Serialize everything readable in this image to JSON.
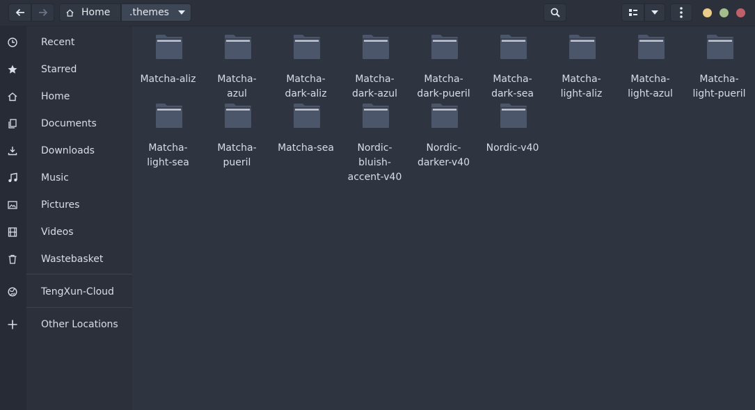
{
  "header": {
    "breadcrumb": [
      {
        "label": "Home"
      },
      {
        "label": ".themes"
      }
    ]
  },
  "sidebar": {
    "items": [
      {
        "label": "Recent",
        "icon": "clock-icon"
      },
      {
        "label": "Starred",
        "icon": "star-icon"
      },
      {
        "label": "Home",
        "icon": "home-icon"
      },
      {
        "label": "Documents",
        "icon": "document-icon"
      },
      {
        "label": "Downloads",
        "icon": "download-icon"
      },
      {
        "label": "Music",
        "icon": "music-icon"
      },
      {
        "label": "Pictures",
        "icon": "picture-icon"
      },
      {
        "label": "Videos",
        "icon": "video-icon"
      },
      {
        "label": "Wastebasket",
        "icon": "trash-icon"
      },
      {
        "label": "TengXun-Cloud",
        "icon": "network-icon"
      },
      {
        "label": "Other Locations",
        "icon": "plus-icon"
      }
    ]
  },
  "files": [
    {
      "name": "Matcha-aliz"
    },
    {
      "name": "Matcha-\nazul"
    },
    {
      "name": "Matcha-\ndark-aliz"
    },
    {
      "name": "Matcha-\ndark-azul"
    },
    {
      "name": "Matcha-\ndark-pueril"
    },
    {
      "name": "Matcha-\ndark-sea"
    },
    {
      "name": "Matcha-\nlight-aliz"
    },
    {
      "name": "Matcha-\nlight-azul"
    },
    {
      "name": "Matcha-\nlight-pueril"
    },
    {
      "name": "Matcha-\nlight-sea"
    },
    {
      "name": "Matcha-\npueril"
    },
    {
      "name": "Matcha-sea"
    },
    {
      "name": "Nordic-\nbluish-\naccent-v40"
    },
    {
      "name": "Nordic-\ndarker-v40"
    },
    {
      "name": "Nordic-v40"
    }
  ],
  "colors": {
    "background": "#2e3440",
    "sidebar": "#2b303b",
    "folder": "#4c566a",
    "close": "#bf616a",
    "maximize": "#a3be8c",
    "minimize": "#ebcb8b"
  }
}
